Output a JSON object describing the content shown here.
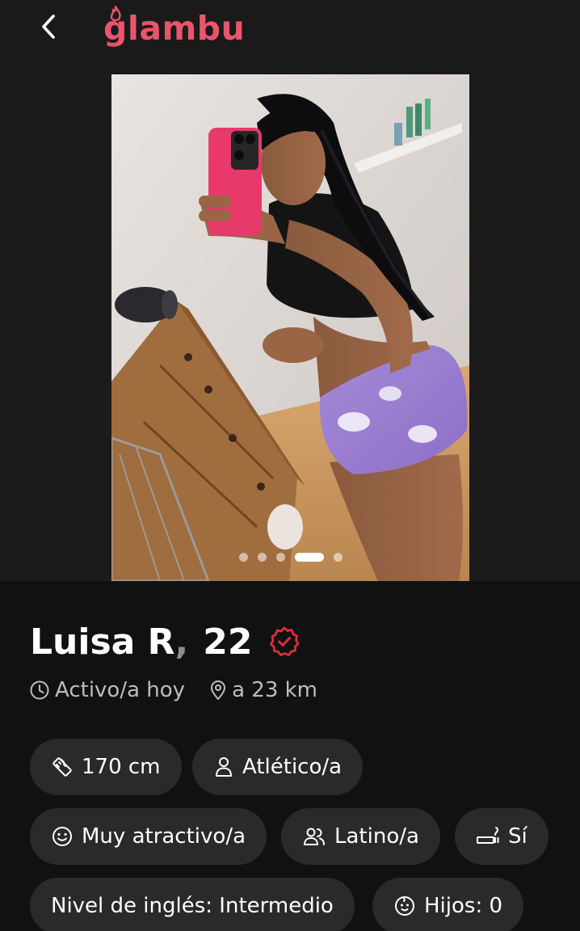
{
  "header": {
    "back_icon": "chevron-left-icon",
    "logo_text": "glambu",
    "logo_color": "#e9556c"
  },
  "photo_carousel": {
    "total_photos": 5,
    "active_index": 3
  },
  "profile": {
    "name": "Luisa R",
    "age": "22",
    "verified": true,
    "verified_color": "#d9303f",
    "status": "Activo/a hoy",
    "distance": "a 23 km"
  },
  "attributes": {
    "height": "170 cm",
    "body_type": "Atlético/a",
    "attractiveness": "Muy atractivo/a",
    "ethnicity": "Latino/a",
    "smoking": "Sí",
    "english_level": "Nivel de inglés: Intermedio",
    "children": "Hijos: 0"
  }
}
